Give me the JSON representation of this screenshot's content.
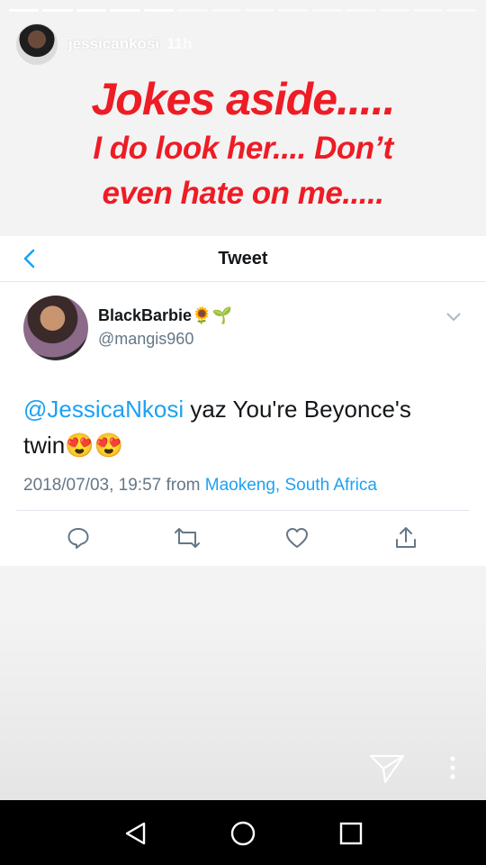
{
  "story": {
    "progress_total": 14,
    "progress_done": 5,
    "username": "jessicankosi",
    "time": "11h"
  },
  "caption": {
    "line1": "Jokes aside.....",
    "line2a": "I do look her....  Don’t",
    "line2b": "even hate on me....."
  },
  "tweet_view": {
    "title": "Tweet",
    "author_name": "BlackBarbie🌻🌱",
    "author_handle": "@mangis960",
    "mention": "@JessicaNkosi",
    "text_rest": " yaz You're Beyonce's twin😍😍",
    "timestamp": "2018/07/03, 19:57 from ",
    "location": "Maokeng, South Africa"
  },
  "colors": {
    "caption_red": "#ee1c25",
    "twitter_blue": "#1da1f2",
    "text_gray": "#657786"
  },
  "icons": [
    "back-icon",
    "chevron-down-icon",
    "reply-icon",
    "retweet-icon",
    "like-icon",
    "share-icon",
    "send-icon",
    "more-icon",
    "nav-back-icon",
    "nav-home-icon",
    "nav-recents-icon"
  ]
}
